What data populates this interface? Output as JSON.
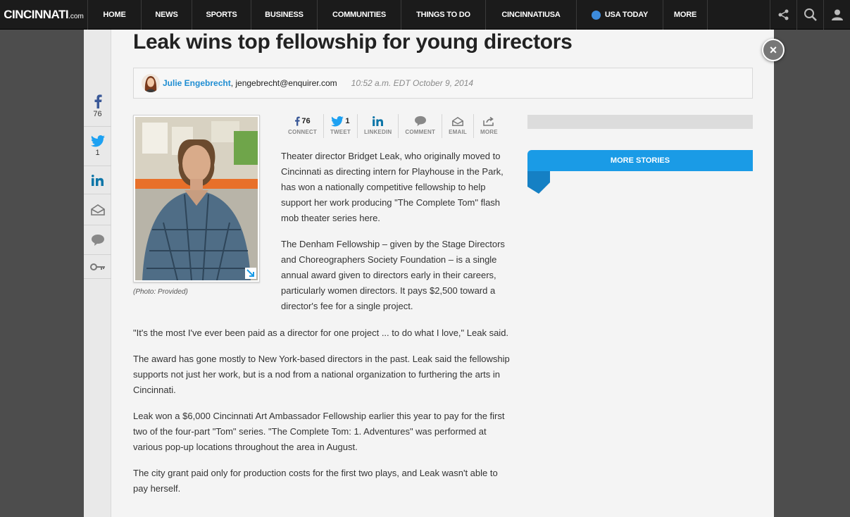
{
  "nav": {
    "logo_main": "CINCINNATI",
    "logo_suffix": ".com",
    "items": [
      {
        "label": "HOME"
      },
      {
        "label": "NEWS"
      },
      {
        "label": "SPORTS"
      },
      {
        "label": "BUSINESS"
      },
      {
        "label": "COMMUNITIES"
      },
      {
        "label": "THINGS TO DO"
      },
      {
        "label": "CINCINNATIUSA"
      },
      {
        "label": "USA TODAY"
      },
      {
        "label": "MORE"
      }
    ],
    "icons": [
      "share-icon",
      "search-icon",
      "user-icon"
    ]
  },
  "leftrail": {
    "facebook_count": "76",
    "twitter_count": "1"
  },
  "article": {
    "headline": "Leak wins top fellowship for young directors",
    "author_name": "Julie Engebrecht",
    "author_email": ", jengebrecht@enquirer.com",
    "date": "10:52 a.m. EDT October 9, 2014",
    "photo_caption": "(Photo: Provided)",
    "lead_paragraphs": [
      "Theater director Bridget Leak, who originally moved to Cincinnati as directing intern for Playhouse in the Park, has won a nationally competitive fellowship to help support her work producing \"The Complete Tom\" flash mob theater series here.",
      "The Denham Fellowship – given by the Stage Directors and Choreographers Society Foundation – is a single annual award given to directors early in their careers, particularly women directors. It pays $2,500 toward a director's fee for a single project."
    ],
    "body_paragraphs": [
      "\"It's the most I've ever been paid as a director for one project ... to do what I love,\" Leak said.",
      "The award has gone mostly to New York-based directors in the past. Leak said the fellowship supports not just her work, but is a nod from a national organization to furthering the arts in Cincinnati.",
      "Leak won a $6,000 Cincinnati Art Ambassador Fellowship earlier this year to pay for the first two of the four-part \"Tom\" series. \"The Complete Tom: 1. Adventures\" was performed at various pop-up locations throughout the area in August.",
      "The city grant paid only for production costs for the first two plays, and Leak wasn't able to pay herself."
    ]
  },
  "sharebar": {
    "facebook_count": "76",
    "twitter_count": "1",
    "labels": [
      "CONNECT",
      "TWEET",
      "LINKEDIN",
      "COMMENT",
      "EMAIL",
      "MORE"
    ]
  },
  "sidebar": {
    "more_stories": "MORE STORIES"
  },
  "close_symbol": "×",
  "colors": {
    "accent_blue": "#1a9be6",
    "author_blue": "#1e8dd2",
    "nav_bg": "#1b1b1b"
  }
}
